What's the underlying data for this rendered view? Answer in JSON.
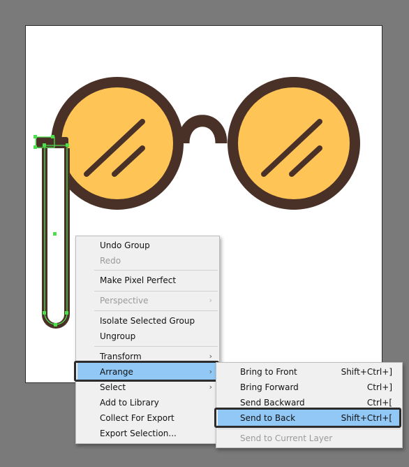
{
  "colors": {
    "canvas_bg": "#7a7a7a",
    "artboard": "#ffffff",
    "frame": "#4a3128",
    "lens": "#ffc456",
    "selection": "#4dde4d",
    "menu_bg": "#f0f0f0",
    "menu_highlight": "#91c8f6",
    "focus_outline": "#2c2c2c"
  },
  "context_menu": {
    "items": [
      {
        "label": "Undo Group",
        "enabled": true
      },
      {
        "label": "Redo",
        "enabled": false
      },
      {
        "label": "Make Pixel Perfect",
        "enabled": true
      },
      {
        "label": "Perspective",
        "enabled": false,
        "submenu_icon": "chevron-right-icon"
      },
      {
        "label": "Isolate Selected Group",
        "enabled": true
      },
      {
        "label": "Ungroup",
        "enabled": true
      },
      {
        "label": "Transform",
        "enabled": true,
        "submenu_icon": "chevron-right-icon"
      },
      {
        "label": "Arrange",
        "enabled": true,
        "highlighted": true,
        "submenu_icon": "chevron-right-icon"
      },
      {
        "label": "Select",
        "enabled": true,
        "submenu_icon": "chevron-right-icon"
      },
      {
        "label": "Add to Library",
        "enabled": true
      },
      {
        "label": "Collect For Export",
        "enabled": true
      },
      {
        "label": "Export Selection...",
        "enabled": true
      }
    ],
    "arrow_glyph": "›"
  },
  "arrange_submenu": {
    "items": [
      {
        "label": "Bring to Front",
        "shortcut": "Shift+Ctrl+]",
        "enabled": true
      },
      {
        "label": "Bring Forward",
        "shortcut": "Ctrl+]",
        "enabled": true
      },
      {
        "label": "Send Backward",
        "shortcut": "Ctrl+[",
        "enabled": true
      },
      {
        "label": "Send to Back",
        "shortcut": "Shift+Ctrl+[",
        "enabled": true,
        "highlighted": true
      },
      {
        "label": "Send to Current Layer",
        "shortcut": "",
        "enabled": false
      }
    ]
  }
}
